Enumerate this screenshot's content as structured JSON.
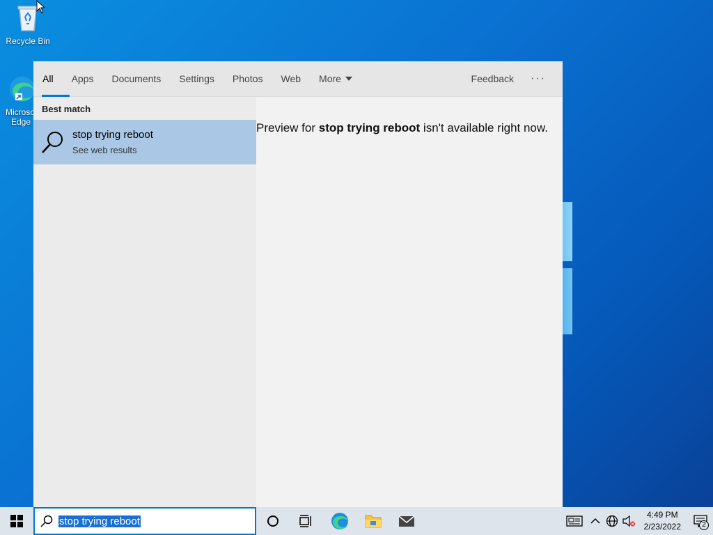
{
  "desktop": {
    "icons": [
      {
        "label": "Recycle Bin",
        "icon": "recycle-bin-icon"
      },
      {
        "label": "Microsoft Edge",
        "icon": "edge-icon"
      }
    ]
  },
  "search_panel": {
    "tabs": [
      {
        "label": "All",
        "active": true
      },
      {
        "label": "Apps"
      },
      {
        "label": "Documents"
      },
      {
        "label": "Settings"
      },
      {
        "label": "Photos"
      },
      {
        "label": "Web"
      },
      {
        "label": "More"
      }
    ],
    "feedback_label": "Feedback",
    "more_options_label": "···",
    "best_match_heading": "Best match",
    "best_match": {
      "title": "stop trying reboot",
      "subtitle": "See web results",
      "icon": "search-icon"
    },
    "preview": {
      "prefix": "Preview for ",
      "query": "stop trying reboot",
      "suffix": " isn't available right now."
    }
  },
  "taskbar": {
    "search_value": "stop trying reboot",
    "time": "4:49 PM",
    "date": "2/23/2022",
    "notification_count": "2",
    "accent_color": "#0078d4"
  }
}
